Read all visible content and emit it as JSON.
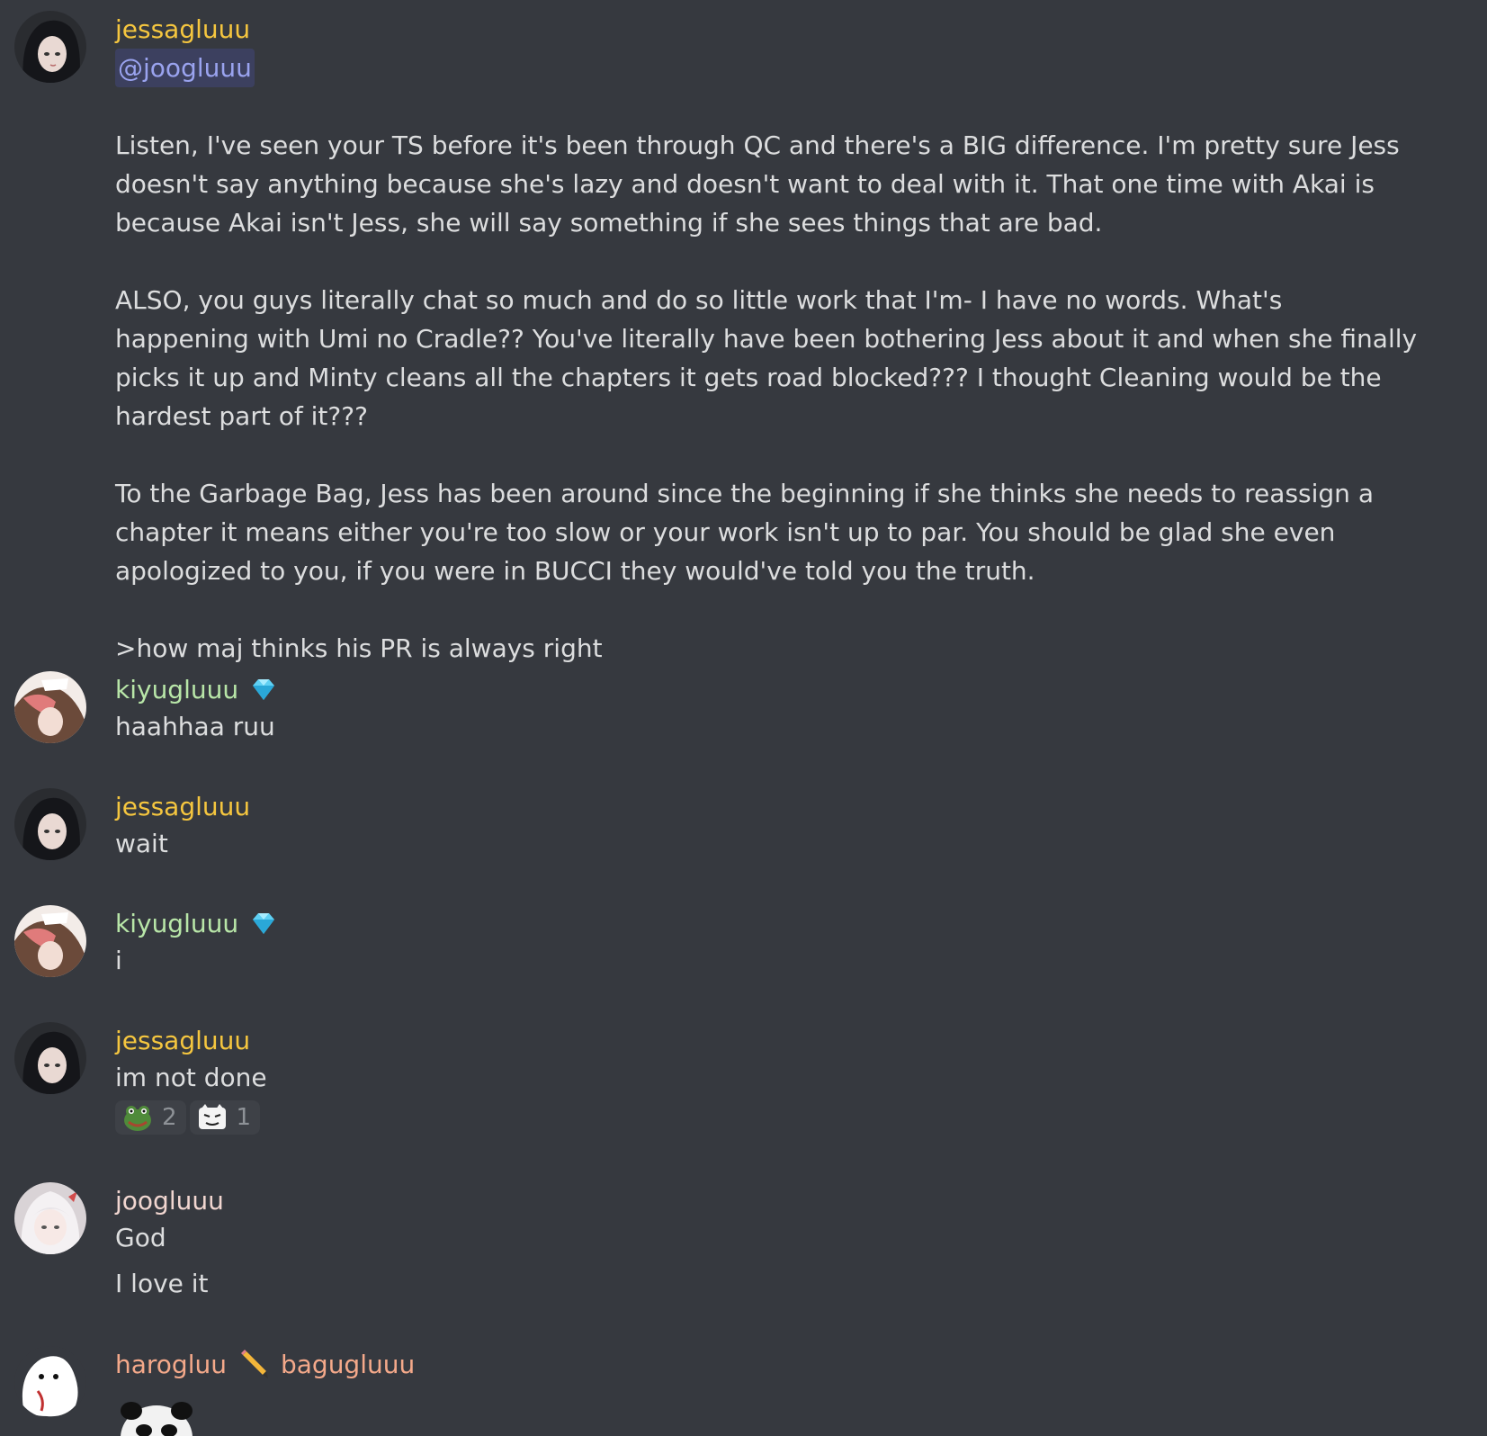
{
  "messages": [
    {
      "author": "jessagluuu",
      "mention": "@joogluuu",
      "paragraphs": [
        "Listen, I've seen your TS before it's been through QC and there's a BIG difference. I'm pretty sure Jess doesn't say anything because she's lazy and doesn't want to deal with it. That one time with Akai is because Akai isn't Jess, she will say something if she sees things that are bad.",
        "ALSO, you guys literally chat so much and do so little work that I'm- I have no words. What's happening with Umi no Cradle?? You've literally have been bothering Jess about it and when she finally picks it up and Minty cleans all the chapters it gets road blocked??? I thought Cleaning would be the hardest part of it???",
        "To the Garbage Bag, Jess has been around since the beginning if she thinks she needs to reassign a chapter it means either you're too slow or your work isn't up to par. You should be glad she even apologized to you, if you were in BUCCI they would've told you the truth.",
        ">how maj thinks his PR is always right"
      ]
    },
    {
      "author": "kiyugluuu",
      "badge": "diamond-icon",
      "text": "haahhaa ruu"
    },
    {
      "author": "jessagluuu",
      "text": "wait"
    },
    {
      "author": "kiyugluuu",
      "badge": "diamond-icon",
      "text": "i"
    },
    {
      "author": "jessagluuu",
      "text": "im not done",
      "reactions": [
        {
          "emoji": "frog-emoji",
          "count": "2"
        },
        {
          "emoji": "cat-face-emoji",
          "count": "1"
        }
      ]
    },
    {
      "author": "joogluuu",
      "lines": [
        "God",
        "I love it"
      ]
    },
    {
      "author": "harogluu",
      "badge": "pencil-icon",
      "author2": "bagugluuu",
      "sticker": "panda-sticker"
    }
  ],
  "colors": {
    "background": "#36393f",
    "text": "#dcddde",
    "jessagluuu": "#f5c63f",
    "kiyugluuu": "#b8e6a8",
    "joogluuu": "#f1d6d0",
    "harogluu": "#f4a98a",
    "mention": "#9aa3ef"
  }
}
